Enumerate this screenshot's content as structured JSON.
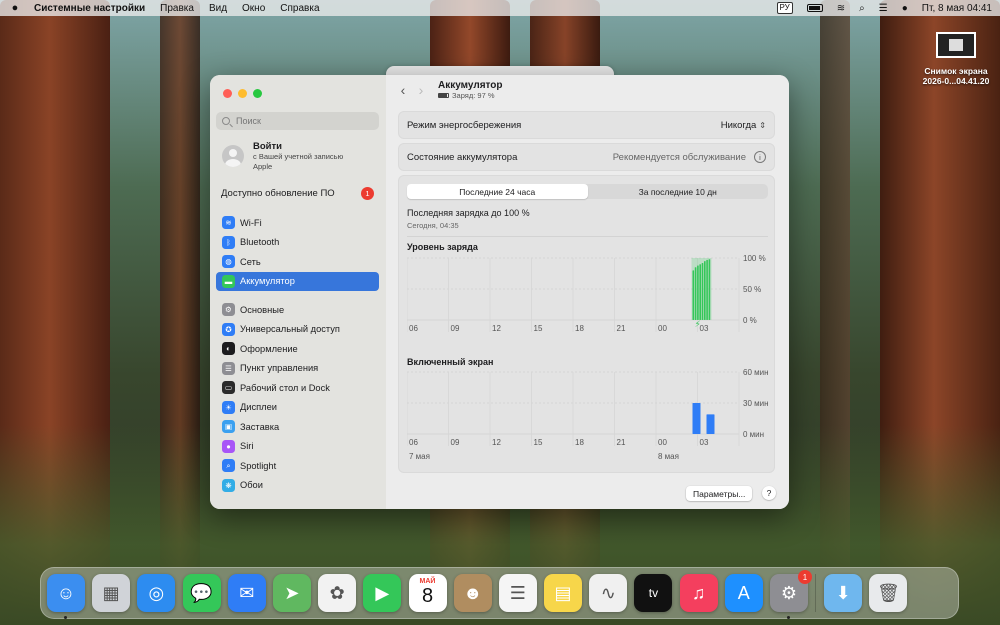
{
  "menubar": {
    "app_name": "Системные настройки",
    "menus": [
      "Правка",
      "Вид",
      "Окно",
      "Справка"
    ],
    "input_lang": "РУ",
    "clock": "Пт, 8 мая  04:41"
  },
  "desktop": {
    "file_label_1": "Снимок экрана",
    "file_label_2": "2026-0...04.41.20"
  },
  "sidebar": {
    "search_placeholder": "Поиск",
    "signin_title": "Войти",
    "signin_sub": "с Вашей учетной записью Apple",
    "update_label": "Доступно обновление ПО",
    "update_count": "1",
    "items": [
      {
        "label": "Wi-Fi",
        "icon": "wifi-icon",
        "glyph": "≋",
        "color": "#2f7df6"
      },
      {
        "label": "Bluetooth",
        "icon": "bluetooth-icon",
        "glyph": "ᛒ",
        "color": "#2f7df6"
      },
      {
        "label": "Сеть",
        "icon": "globe-icon",
        "glyph": "◍",
        "color": "#2f7df6"
      },
      {
        "label": "Аккумулятор",
        "icon": "battery-icon",
        "glyph": "▬",
        "color": "#34c759"
      },
      {
        "label": "Основные",
        "icon": "gear-icon",
        "glyph": "⚙",
        "color": "#8e8e93"
      },
      {
        "label": "Универсальный доступ",
        "icon": "accessibility-icon",
        "glyph": "✪",
        "color": "#2f7df6"
      },
      {
        "label": "Оформление",
        "icon": "appearance-icon",
        "glyph": "◐",
        "color": "#1c1c1e"
      },
      {
        "label": "Пункт управления",
        "icon": "control-center-icon",
        "glyph": "☰",
        "color": "#8e8e93"
      },
      {
        "label": "Рабочий стол и Dock",
        "icon": "desktop-dock-icon",
        "glyph": "▭",
        "color": "#2b2b2b"
      },
      {
        "label": "Дисплеи",
        "icon": "display-icon",
        "glyph": "☀",
        "color": "#2f7df6"
      },
      {
        "label": "Заставка",
        "icon": "screensaver-icon",
        "glyph": "▣",
        "color": "#3aa0f0"
      },
      {
        "label": "Siri",
        "icon": "siri-icon",
        "glyph": "●",
        "color": "#a855f7"
      },
      {
        "label": "Spotlight",
        "icon": "spotlight-icon",
        "glyph": "⌕",
        "color": "#2f7df6"
      },
      {
        "label": "Обои",
        "icon": "wallpaper-icon",
        "glyph": "❋",
        "color": "#32ade6"
      }
    ]
  },
  "header": {
    "title": "Аккумулятор",
    "subtitle": "Заряд: 97 %"
  },
  "settings": {
    "low_power_label": "Режим энергосбережения",
    "low_power_value": "Никогда",
    "health_label": "Состояние аккумулятора",
    "health_value": "Рекомендуется обслуживание"
  },
  "usage": {
    "tabs": [
      "Последние 24 часа",
      "За последние 10 дн"
    ],
    "selected_tab": 0,
    "last_charge": "Последняя зарядка до 100 %",
    "last_charge_time": "Сегодня, 04:35",
    "buttons": {
      "params": "Параметры...",
      "help": "?"
    }
  },
  "chart_data": [
    {
      "type": "bar",
      "title": "Уровень заряда",
      "x_ticks": [
        "06",
        "09",
        "12",
        "15",
        "18",
        "21",
        "00",
        "03"
      ],
      "y_ticks": [
        "100 %",
        "50 %",
        "0 %"
      ],
      "ylim": [
        0,
        100
      ],
      "series": [
        {
          "color": "#34c759",
          "values": [
            80,
            85,
            88,
            90,
            92,
            95,
            97,
            98
          ]
        }
      ],
      "charging_marker": "⚡"
    },
    {
      "type": "bar",
      "title": "Включенный экран",
      "x_ticks": [
        "06",
        "09",
        "12",
        "15",
        "18",
        "21",
        "00",
        "03"
      ],
      "y_ticks": [
        "60 мин",
        "30 мин",
        "0 мин"
      ],
      "ylim": [
        0,
        60
      ],
      "date_labels": [
        "7 мая",
        "8 мая"
      ],
      "series": [
        {
          "color": "#2f7df6",
          "values": [
            30,
            19
          ]
        }
      ]
    }
  ],
  "dock": {
    "apps": [
      {
        "name": "finder",
        "glyph": "☺",
        "color": "#3b8ef0"
      },
      {
        "name": "launchpad",
        "glyph": "▦",
        "color": "#d0d3d8"
      },
      {
        "name": "safari",
        "glyph": "◎",
        "color": "#2d8cf0"
      },
      {
        "name": "messages",
        "glyph": "💬",
        "color": "#34c759"
      },
      {
        "name": "mail",
        "glyph": "✉",
        "color": "#2f7df6"
      },
      {
        "name": "maps",
        "glyph": "➤",
        "color": "#60b860"
      },
      {
        "name": "photos",
        "glyph": "✿",
        "color": "#f2f2f2"
      },
      {
        "name": "facetime",
        "glyph": "▶",
        "color": "#34c759"
      },
      {
        "name": "calendar",
        "month": "МАЙ",
        "day": "8"
      },
      {
        "name": "contacts",
        "glyph": "☻",
        "color": "#b08d60"
      },
      {
        "name": "reminders",
        "glyph": "☰",
        "color": "#f5f5f5"
      },
      {
        "name": "notes",
        "glyph": "▤",
        "color": "#f7d64a"
      },
      {
        "name": "freeform",
        "glyph": "∿",
        "color": "#f0f0f0"
      },
      {
        "name": "tv",
        "glyph": "tv",
        "color": "#111111"
      },
      {
        "name": "music",
        "glyph": "♫",
        "color": "#f43f5e"
      },
      {
        "name": "app-store",
        "glyph": "A",
        "color": "#1e90ff"
      },
      {
        "name": "system-settings",
        "glyph": "⚙",
        "color": "#8e8e93",
        "badge": "1"
      },
      {
        "name": "downloads",
        "glyph": "⬇",
        "color": "#6fb7ee"
      },
      {
        "name": "trash",
        "glyph": "🗑",
        "color": "#e8eaec"
      }
    ]
  }
}
